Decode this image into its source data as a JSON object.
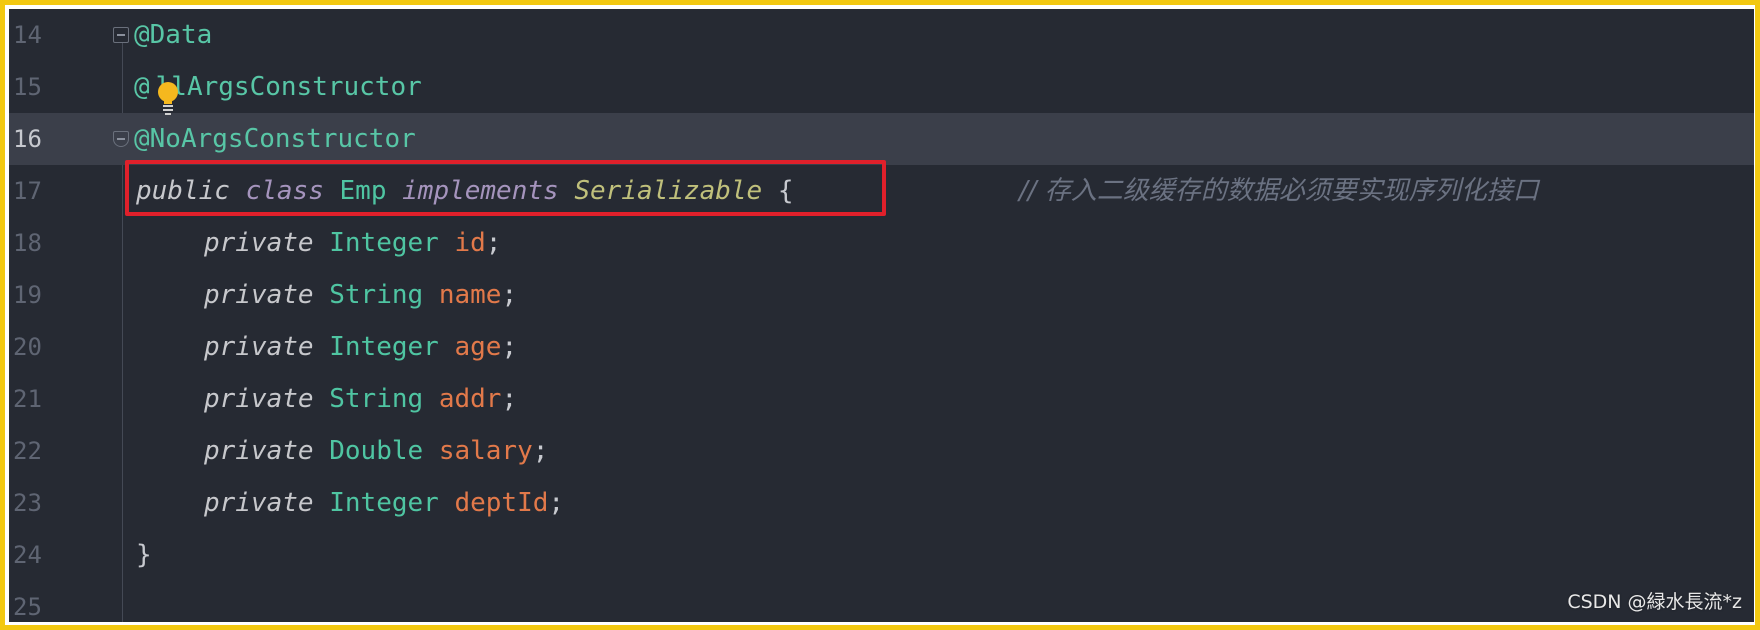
{
  "editor": {
    "lines": [
      {
        "num": "14"
      },
      {
        "num": "15"
      },
      {
        "num": "16"
      },
      {
        "num": "17"
      },
      {
        "num": "18"
      },
      {
        "num": "19"
      },
      {
        "num": "20"
      },
      {
        "num": "21"
      },
      {
        "num": "22"
      },
      {
        "num": "23"
      },
      {
        "num": "24"
      },
      {
        "num": "25"
      }
    ],
    "annotations": {
      "data": "@Data",
      "all_args_prefix": "@",
      "all_args_rest": "llArgsConstructor",
      "no_args": "@NoArgsConstructor"
    },
    "class_decl": {
      "public": "public",
      "class_kw": "class",
      "name": "Emp",
      "implements": "implements",
      "interface": "Serializable",
      "brace": "{",
      "comment": "// 存入二级缓存的数据必须要实现序列化接口"
    },
    "fields": [
      {
        "modifier": "private",
        "type": "Integer",
        "name": "id",
        "semi": ";"
      },
      {
        "modifier": "private",
        "type": "String",
        "name": "name",
        "semi": ";"
      },
      {
        "modifier": "private",
        "type": "Integer",
        "name": "age",
        "semi": ";"
      },
      {
        "modifier": "private",
        "type": "String",
        "name": "addr",
        "semi": ";"
      },
      {
        "modifier": "private",
        "type": "Double",
        "name": "salary",
        "semi": ";"
      },
      {
        "modifier": "private",
        "type": "Integer",
        "name": "deptId",
        "semi": ";"
      }
    ],
    "closing_brace": "}",
    "current_line": "16",
    "bulb_icon": "lightbulb-icon"
  },
  "colors": {
    "background": "#262a33",
    "current_line": "#3b3f4a",
    "annotation": "#58c6a6",
    "field": "#e2794a",
    "highlight": "#e0202b",
    "frame": "#f2c811"
  },
  "watermark": "CSDN @緑水長流*z"
}
